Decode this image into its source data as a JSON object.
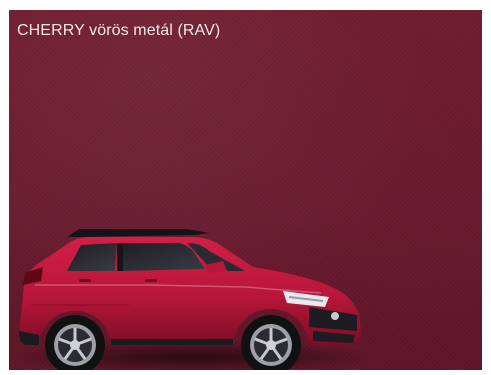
{
  "swatch": {
    "label": "CHERRY vörös metál (RAV)",
    "color": "#6b1a2e"
  },
  "car": {
    "body_color": "#b8163a",
    "icon": "suv-car-image"
  }
}
